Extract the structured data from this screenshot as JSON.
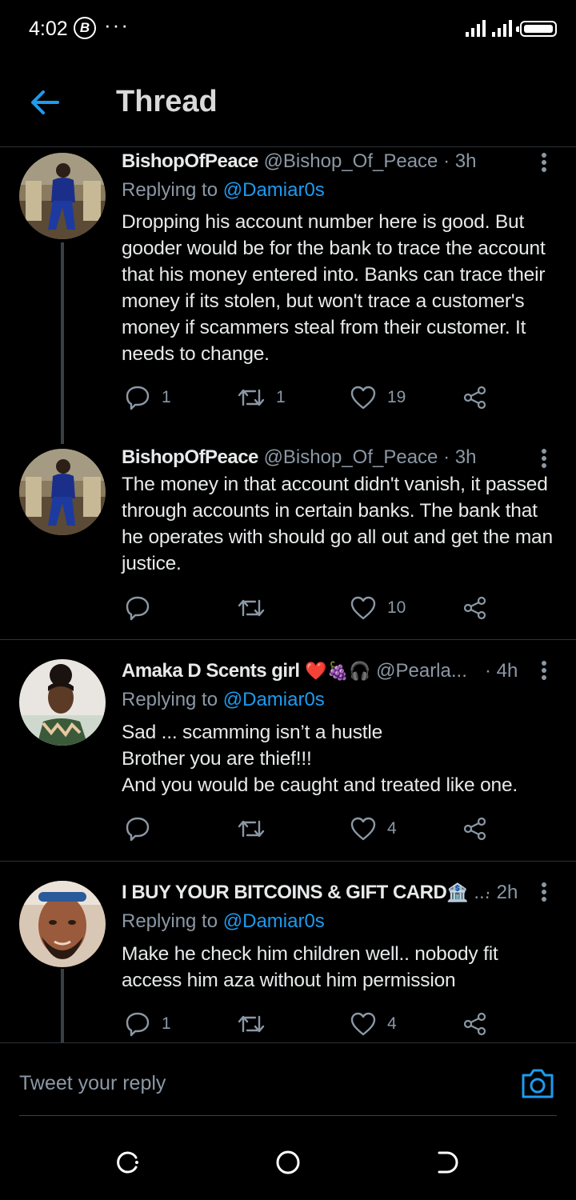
{
  "status_bar": {
    "time": "4:02",
    "badge": "B",
    "dots": "···"
  },
  "header": {
    "title": "Thread",
    "back_icon": "arrow-left-icon"
  },
  "colors": {
    "accent": "#1d9bf0",
    "background": "#000000",
    "muted": "#8b98a5"
  },
  "tweets": [
    {
      "name": "BishopOfPeace",
      "handle": "@Bishop_Of_Peace",
      "time": "· 3h",
      "reply_prefix": "Replying to ",
      "reply_mention": "@Damiar0s",
      "text": "Dropping his account number here is good. But gooder would be for the bank to trace the account that his money entered into. Banks can trace their money if its stolen, but won't trace a customer's money if scammers steal from their customer. It needs to change.",
      "replies": "1",
      "retweets": "1",
      "likes": "19"
    },
    {
      "name": "BishopOfPeace",
      "handle": "@Bishop_Of_Peace",
      "time": "· 3h",
      "text": "The money in that account didn't vanish, it passed through accounts in certain banks. The bank that he operates with should go all out and get the man justice.",
      "replies": "",
      "retweets": "",
      "likes": "10"
    },
    {
      "name": "Amaka D Scents girl",
      "name_emoji": "❤️🍇🎧",
      "handle": "@Pearla...",
      "time": "· 4h",
      "reply_prefix": "Replying to ",
      "reply_mention": "@Damiar0s",
      "text_lines": [
        "Sad ... scamming isn’t a hustle",
        "Brother you are thief!!!",
        "And you would be caught and treated like one."
      ],
      "replies": "",
      "retweets": "",
      "likes": "4"
    },
    {
      "name": "I BUY YOUR BITCOINS & GIFT CARD",
      "name_emoji": "🏦",
      "handle": "...",
      "time": "· 2h",
      "reply_prefix": "Replying to ",
      "reply_mention": "@Damiar0s",
      "text": "Make he check him children well.. nobody fit access him aza without him permission",
      "replies": "1",
      "retweets": "",
      "likes": "4"
    }
  ],
  "reply_box": {
    "placeholder": "Tweet your reply",
    "camera_icon": "camera-icon"
  },
  "nav": {
    "recents_icon": "recents-icon",
    "home_icon": "home-icon",
    "back_icon": "back-icon"
  }
}
